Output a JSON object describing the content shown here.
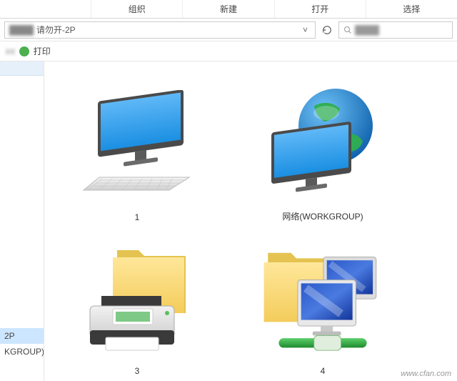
{
  "ribbon": {
    "tabs": [
      "",
      "组织",
      "新建",
      "打开",
      "选择"
    ]
  },
  "address": {
    "fragment": "████",
    "text": "请勿开-2P",
    "dropdown": "˅"
  },
  "search": {
    "placeholder": "████"
  },
  "toolbar": {
    "left": "int",
    "print_label": "打印"
  },
  "sidebar": {
    "items": [
      "2P",
      "KGROUP)"
    ]
  },
  "items": [
    {
      "label": "1",
      "icon": "computer"
    },
    {
      "label": "网络(WORKGROUP)",
      "icon": "network-globe"
    },
    {
      "label": "3",
      "icon": "printer-folder"
    },
    {
      "label": "4",
      "icon": "folder-network"
    }
  ],
  "watermark": "www.cfan.com"
}
